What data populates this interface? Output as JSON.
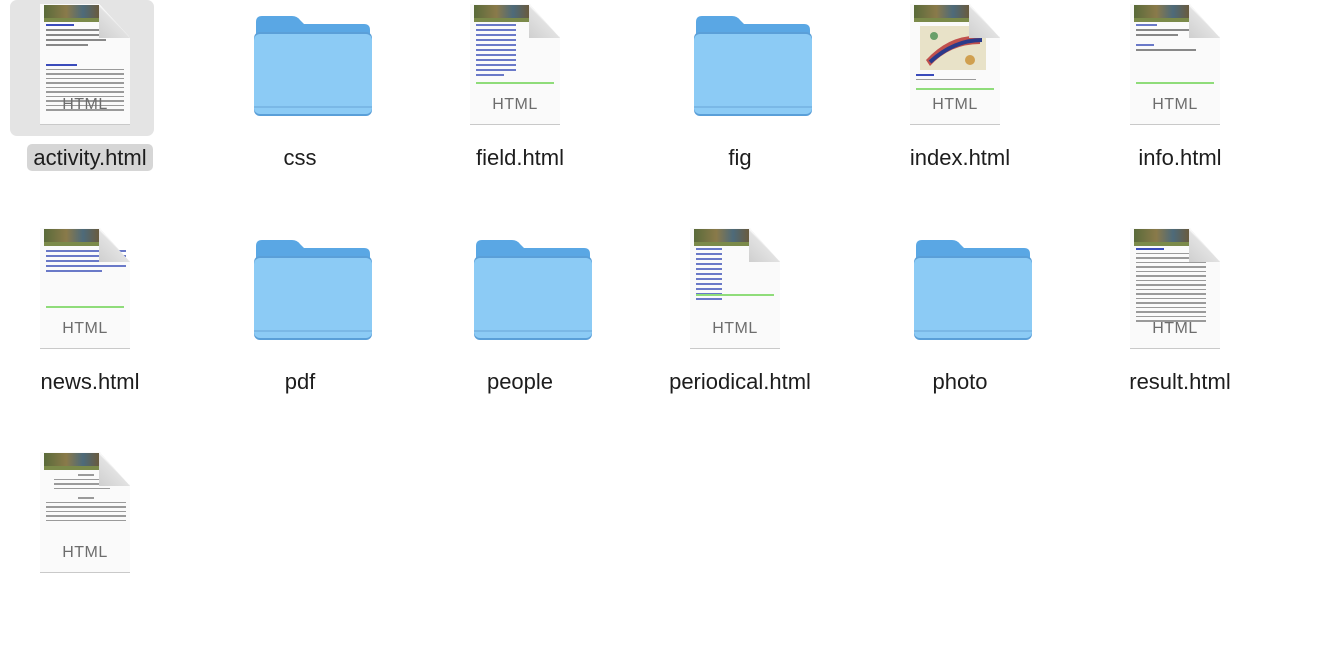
{
  "files": [
    {
      "name": "activity.html",
      "kind": "html",
      "badge": "HTML",
      "selected": true
    },
    {
      "name": "css",
      "kind": "folder"
    },
    {
      "name": "field.html",
      "kind": "html",
      "badge": "HTML"
    },
    {
      "name": "fig",
      "kind": "folder"
    },
    {
      "name": "index.html",
      "kind": "html",
      "badge": "HTML"
    },
    {
      "name": "info.html",
      "kind": "html",
      "badge": "HTML"
    },
    {
      "name": "news.html",
      "kind": "html",
      "badge": "HTML"
    },
    {
      "name": "pdf",
      "kind": "folder"
    },
    {
      "name": "people",
      "kind": "folder"
    },
    {
      "name": "periodical.html",
      "kind": "html",
      "badge": "HTML"
    },
    {
      "name": "photo",
      "kind": "folder"
    },
    {
      "name": "result.html",
      "kind": "html",
      "badge": "HTML"
    },
    {
      "name": "",
      "kind": "html",
      "badge": "HTML"
    }
  ],
  "colors": {
    "folder_front": "#8ccbf5",
    "folder_back": "#5aa7e4",
    "selection": "#d6d6d6"
  }
}
